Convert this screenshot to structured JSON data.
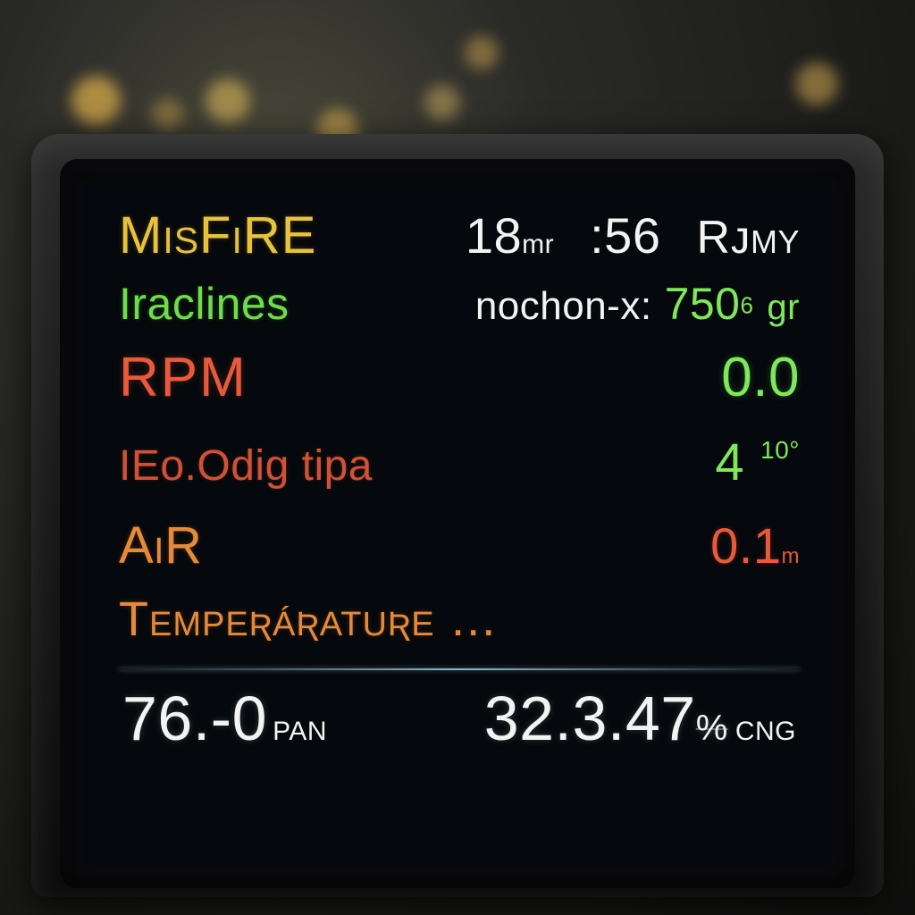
{
  "colors": {
    "yellow": "#e8c23a",
    "white": "#f2f3f2",
    "green": "#6fdc4a",
    "green_bright": "#7ee85a",
    "red": "#e85a3a",
    "orange": "#e68a3a"
  },
  "header": {
    "title": "MisFiRE",
    "reading1_value": "18",
    "reading1_unit": "mr",
    "reading2_value": ":56",
    "reading3_label": "Rᴊmy"
  },
  "rows": [
    {
      "label": "Iraclines",
      "mid_label": "nochon-x:",
      "value": "750",
      "value_sup": "6",
      "unit": "gr"
    },
    {
      "label": "RPM",
      "value": "0.0"
    },
    {
      "label": "IEo.Odig tipa",
      "value": "4",
      "unit": "10°"
    },
    {
      "label": "AiR",
      "value": "0.1",
      "unit": "m"
    },
    {
      "label": "Tempeʀáʀatuʀe …"
    }
  ],
  "footer": {
    "left_value": "76.-0",
    "left_unit": "PAN",
    "right_value": "32.3.47",
    "right_unit": "CNG",
    "right_value_suffix": "%"
  }
}
